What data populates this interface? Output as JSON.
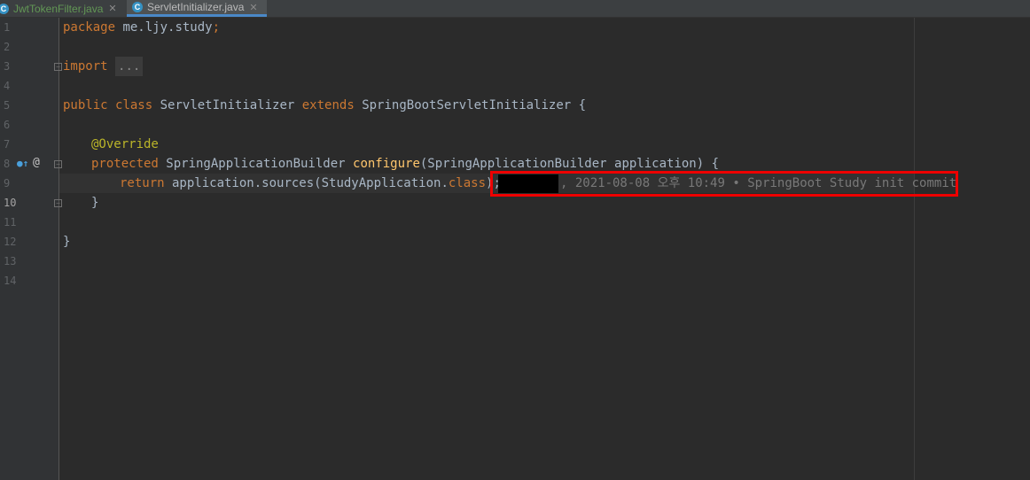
{
  "tabs": [
    {
      "icon": "C",
      "label": "JwtTokenFilter.java",
      "close": "✕"
    },
    {
      "icon": "C",
      "label": "ServletInitializer.java",
      "close": "✕"
    }
  ],
  "line_numbers": [
    "1",
    "2",
    "3",
    "4",
    "5",
    "6",
    "7",
    "8",
    "9",
    "10",
    "11",
    "12",
    "13",
    "14"
  ],
  "code": {
    "l1_kw": "package",
    "l1_rest": " me.ljy.study",
    "l1_semi": ";",
    "l3_kw": "import",
    "l3_fold": "...",
    "l6_kw1": "public",
    "l6_kw2": "class",
    "l6_name": " ServletInitializer ",
    "l6_kw3": "extends",
    "l6_rest": " SpringBootServletInitializer {",
    "l8_ann": "@Override",
    "l9_kw": "protected",
    "l9_type": " SpringApplicationBuilder ",
    "l9_fn": "configure",
    "l9_rest": "(SpringApplicationBuilder application) {",
    "l10_kw": "return",
    "l10_rest": " application.sources(StudyApplication.",
    "l10_kw2": "class",
    "l10_end": ");",
    "l11": "}",
    "l13": "}"
  },
  "blame": ", 2021-08-08 오후 10:49 • SpringBoot Study init commit"
}
